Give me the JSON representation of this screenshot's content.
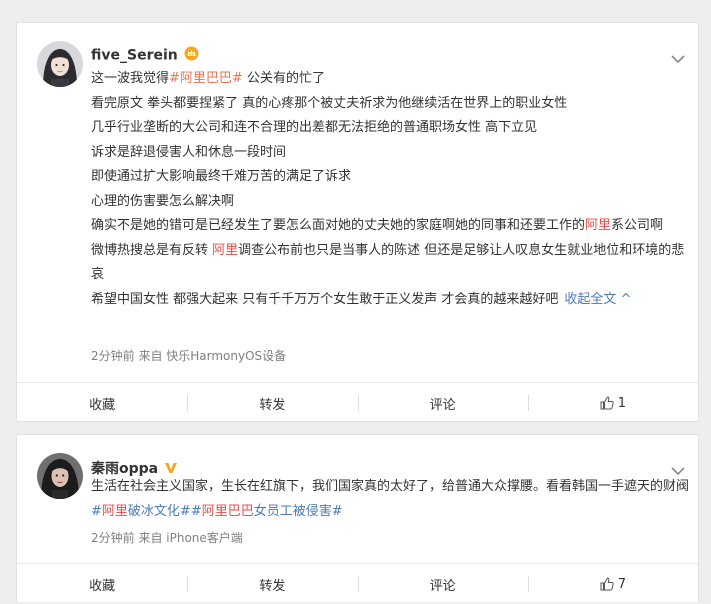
{
  "posts": [
    {
      "user": {
        "name": "five_Serein",
        "badge": "crown-badge"
      },
      "lines": [
        {
          "segments": [
            {
              "t": "这一波我觉得",
              "c": ""
            },
            {
              "t": "#阿里巴巴#",
              "c": "link"
            },
            {
              "t": " 公关有的忙了",
              "c": ""
            }
          ]
        },
        {
          "segments": [
            {
              "t": "看完原文 拳头都要捏紧了 真的心疼那个被丈夫祈求为他继续活在世界上的职业女性",
              "c": ""
            }
          ]
        },
        {
          "segments": [
            {
              "t": "几乎行业垄断的大公司和连不合理的出差都无法拒绝的普通职场女性 高下立见",
              "c": ""
            }
          ]
        },
        {
          "segments": [
            {
              "t": "诉求是辞退侵害人和休息一段时间",
              "c": ""
            }
          ]
        },
        {
          "segments": [
            {
              "t": "即使通过扩大影响最终千难万苦的满足了诉求",
              "c": ""
            }
          ]
        },
        {
          "segments": [
            {
              "t": "心理的伤害要怎么解决啊",
              "c": ""
            }
          ]
        },
        {
          "wrap": true,
          "segments": [
            {
              "t": "确实不是她的错可是已经发生了要怎么面对她的丈夫她的家庭啊她的同事和还要工作的",
              "c": ""
            },
            {
              "t": "阿里",
              "c": "hl"
            },
            {
              "t": "系公司啊",
              "c": ""
            }
          ]
        },
        {
          "wrap": true,
          "segments": [
            {
              "t": "微博热搜总是有反转 ",
              "c": ""
            },
            {
              "t": "阿里",
              "c": "hl"
            },
            {
              "t": "调查公布前也只是当事人的陈述 但还是足够让人叹息女生就业地位和环境的悲哀",
              "c": ""
            }
          ]
        },
        {
          "segments": [
            {
              "t": "希望中国女性 都强大起来 只有千千万万个女生敢于正义发声 才会真的越来越好吧",
              "c": ""
            }
          ]
        }
      ],
      "fold_label": "收起全文 ^",
      "meta": "2分钟前  来自 快乐HarmonyOS设备",
      "actions": {
        "collect": "收藏",
        "repost": "转发",
        "comment": "评论",
        "like_count": "1"
      }
    },
    {
      "user": {
        "name": "秦雨oppa",
        "badge": "verified-v-badge"
      },
      "lines": [
        {
          "wrap": true,
          "segments": [
            {
              "t": "生活在社会主义国家，生长在红旗下，我们国家真的太好了，给普通大众撑腰。看看韩国一手遮天的财阀",
              "c": ""
            },
            {
              "t": "#",
              "c": "bluelink"
            },
            {
              "t": "阿里",
              "c": "hl"
            },
            {
              "t": "破冰文化##",
              "c": "bluelink"
            },
            {
              "t": "阿里巴巴",
              "c": "hl"
            },
            {
              "t": "女员工被侵害#",
              "c": "bluelink"
            }
          ]
        }
      ],
      "meta": "2分钟前  来自 iPhone客户端",
      "actions": {
        "collect": "收藏",
        "repost": "转发",
        "comment": "评论",
        "like_count": "7"
      }
    }
  ],
  "colors": {
    "topic_link": "#eb7350",
    "blue_link": "#4e7ab8",
    "highlight": "#eb4c45",
    "badge_gold": "#f5a623"
  }
}
